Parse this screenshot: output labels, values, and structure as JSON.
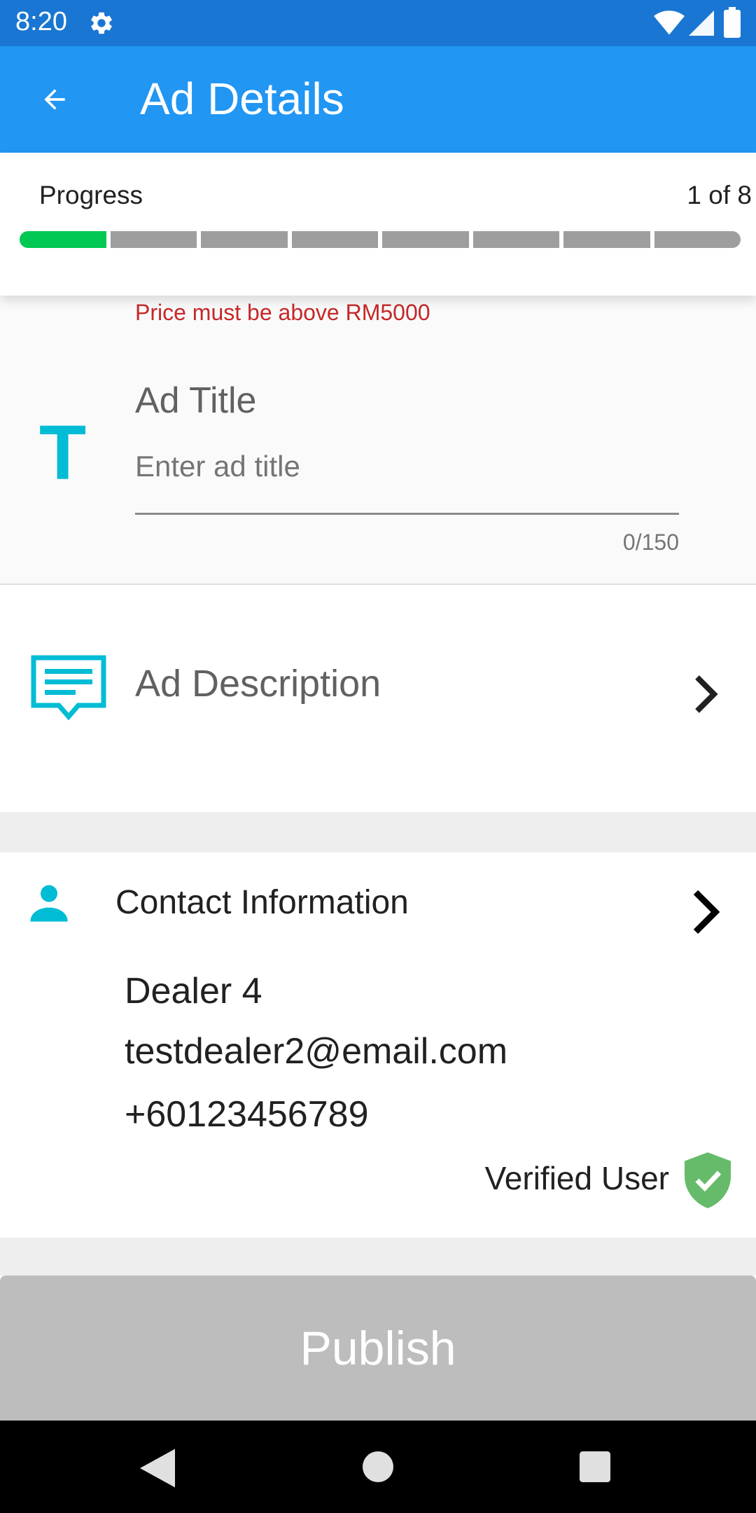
{
  "status_bar": {
    "time": "8:20",
    "icons": [
      "gear-icon",
      "wifi-icon",
      "signal-icon",
      "battery-icon"
    ]
  },
  "app_bar": {
    "title": "Ad Details",
    "back_icon": "arrow-back-icon",
    "background": "#2196f3"
  },
  "progress": {
    "label": "Progress",
    "count_text": "1 of 8",
    "current_step": 1,
    "total_steps": 8,
    "done_color": "#00c853",
    "pending_color": "#9e9e9e"
  },
  "ad_title": {
    "error": "Price must be above RM5000",
    "icon": "T",
    "label": "Ad Title",
    "value": "",
    "placeholder": "Enter ad title",
    "counter": "0/150"
  },
  "ad_description": {
    "icon": "description-icon",
    "label": "Ad Description"
  },
  "contact": {
    "heading": "Contact Information",
    "name": "Dealer 4",
    "email": "testdealer2@email.com",
    "phone": "+60123456789",
    "verified_label": "Verified User",
    "verified_color": "#66bb6a"
  },
  "publish": {
    "label": "Publish",
    "enabled": false
  },
  "nav": {
    "icons": [
      "nav-back-icon",
      "nav-home-icon",
      "nav-recents-icon"
    ]
  }
}
